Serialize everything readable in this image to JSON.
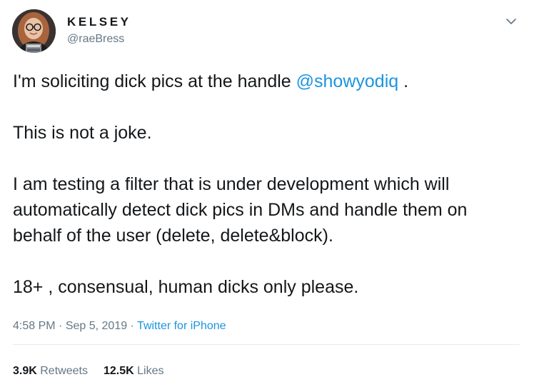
{
  "user": {
    "display_name": "KELSEY",
    "handle": "@raeBress",
    "avatar_icon": "profile-photo"
  },
  "menu_icon": "chevron-down-icon",
  "tweet": {
    "line1_before": "I'm soliciting dick pics at the handle ",
    "mention": "@showyodiq",
    "line1_after": " .",
    "paragraph2": "This is not a joke.",
    "paragraph3": "I am testing a filter that is under development which will automatically detect dick pics in DMs and handle them on behalf of the user (delete, delete&block).",
    "paragraph4": "18+ , consensual, human dicks only please."
  },
  "meta": {
    "time": "4:58 PM",
    "separator1": " · ",
    "date": "Sep 5, 2019",
    "separator2": " · ",
    "source": "Twitter for iPhone"
  },
  "stats": {
    "retweets_count": "3.9K",
    "retweets_label": "Retweets",
    "likes_count": "12.5K",
    "likes_label": "Likes"
  },
  "colors": {
    "link": "#1b95e0",
    "secondary_text": "#657786",
    "primary_text": "#14171a",
    "divider": "#e6ecf0"
  }
}
